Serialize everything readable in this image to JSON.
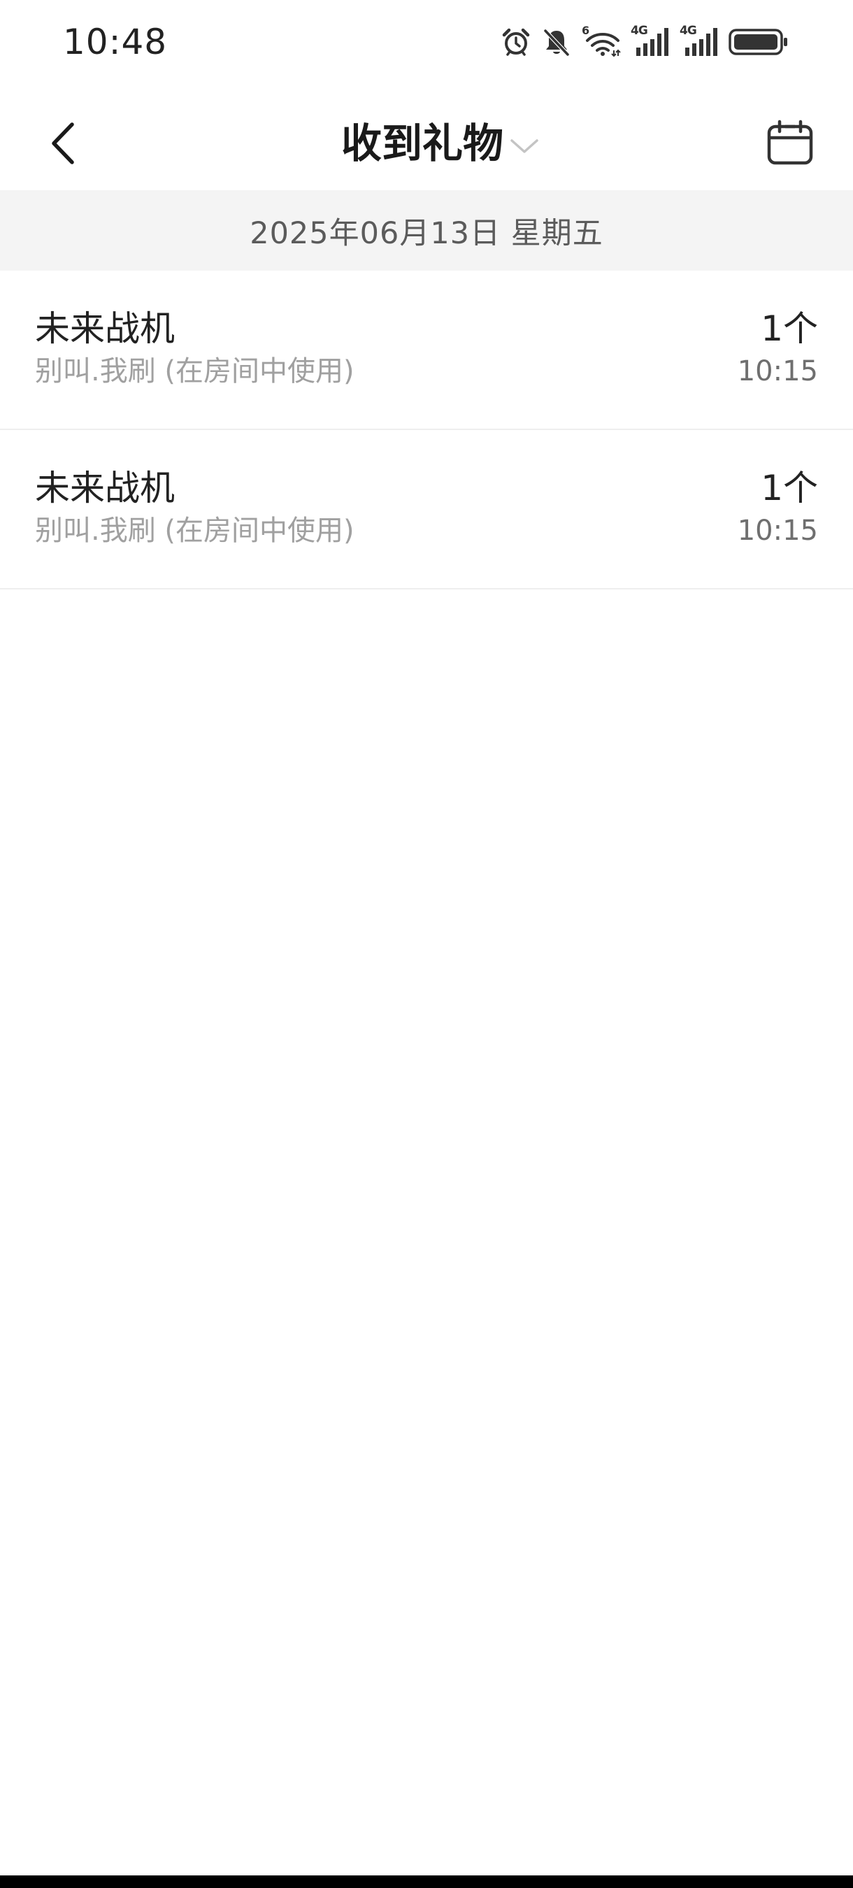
{
  "status_bar": {
    "time": "10:48",
    "icons": [
      "alarm-icon",
      "mute-bell-icon",
      "wifi-6-icon",
      "signal-4g-icon",
      "signal-4g-icon",
      "battery-icon"
    ],
    "wifi_label": "6",
    "network_label_1": "4G",
    "network_label_2": "4G"
  },
  "nav": {
    "title": "收到礼物",
    "back_icon": "chevron-left-icon",
    "dropdown_icon": "chevron-down-icon",
    "calendar_icon": "calendar-icon"
  },
  "date_header": {
    "text": "2025年06月13日 星期五"
  },
  "gifts": [
    {
      "name": "未来战机",
      "source": "别叫.我刷 (在房间中使用)",
      "quantity": "1个",
      "time": "10:15"
    },
    {
      "name": "未来战机",
      "source": "别叫.我刷 (在房间中使用)",
      "quantity": "1个",
      "time": "10:15"
    }
  ],
  "colors": {
    "title": "#1a1a1a",
    "subtitle": "#a0a0a0",
    "date_bg": "#f4f4f4",
    "divider": "#eeeeee"
  }
}
